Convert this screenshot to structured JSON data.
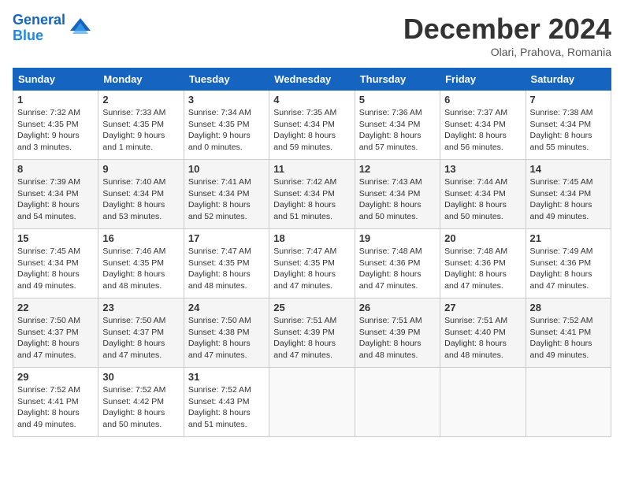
{
  "header": {
    "logo_line1": "General",
    "logo_line2": "Blue",
    "month": "December 2024",
    "location": "Olari, Prahova, Romania"
  },
  "days_of_week": [
    "Sunday",
    "Monday",
    "Tuesday",
    "Wednesday",
    "Thursday",
    "Friday",
    "Saturday"
  ],
  "weeks": [
    [
      {
        "day": 1,
        "sunrise": "7:32 AM",
        "sunset": "4:35 PM",
        "daylight": "9 hours and 3 minutes."
      },
      {
        "day": 2,
        "sunrise": "7:33 AM",
        "sunset": "4:35 PM",
        "daylight": "9 hours and 1 minute."
      },
      {
        "day": 3,
        "sunrise": "7:34 AM",
        "sunset": "4:35 PM",
        "daylight": "9 hours and 0 minutes."
      },
      {
        "day": 4,
        "sunrise": "7:35 AM",
        "sunset": "4:34 PM",
        "daylight": "8 hours and 59 minutes."
      },
      {
        "day": 5,
        "sunrise": "7:36 AM",
        "sunset": "4:34 PM",
        "daylight": "8 hours and 57 minutes."
      },
      {
        "day": 6,
        "sunrise": "7:37 AM",
        "sunset": "4:34 PM",
        "daylight": "8 hours and 56 minutes."
      },
      {
        "day": 7,
        "sunrise": "7:38 AM",
        "sunset": "4:34 PM",
        "daylight": "8 hours and 55 minutes."
      }
    ],
    [
      {
        "day": 8,
        "sunrise": "7:39 AM",
        "sunset": "4:34 PM",
        "daylight": "8 hours and 54 minutes."
      },
      {
        "day": 9,
        "sunrise": "7:40 AM",
        "sunset": "4:34 PM",
        "daylight": "8 hours and 53 minutes."
      },
      {
        "day": 10,
        "sunrise": "7:41 AM",
        "sunset": "4:34 PM",
        "daylight": "8 hours and 52 minutes."
      },
      {
        "day": 11,
        "sunrise": "7:42 AM",
        "sunset": "4:34 PM",
        "daylight": "8 hours and 51 minutes."
      },
      {
        "day": 12,
        "sunrise": "7:43 AM",
        "sunset": "4:34 PM",
        "daylight": "8 hours and 50 minutes."
      },
      {
        "day": 13,
        "sunrise": "7:44 AM",
        "sunset": "4:34 PM",
        "daylight": "8 hours and 50 minutes."
      },
      {
        "day": 14,
        "sunrise": "7:45 AM",
        "sunset": "4:34 PM",
        "daylight": "8 hours and 49 minutes."
      }
    ],
    [
      {
        "day": 15,
        "sunrise": "7:45 AM",
        "sunset": "4:34 PM",
        "daylight": "8 hours and 49 minutes."
      },
      {
        "day": 16,
        "sunrise": "7:46 AM",
        "sunset": "4:35 PM",
        "daylight": "8 hours and 48 minutes."
      },
      {
        "day": 17,
        "sunrise": "7:47 AM",
        "sunset": "4:35 PM",
        "daylight": "8 hours and 48 minutes."
      },
      {
        "day": 18,
        "sunrise": "7:47 AM",
        "sunset": "4:35 PM",
        "daylight": "8 hours and 47 minutes."
      },
      {
        "day": 19,
        "sunrise": "7:48 AM",
        "sunset": "4:36 PM",
        "daylight": "8 hours and 47 minutes."
      },
      {
        "day": 20,
        "sunrise": "7:48 AM",
        "sunset": "4:36 PM",
        "daylight": "8 hours and 47 minutes."
      },
      {
        "day": 21,
        "sunrise": "7:49 AM",
        "sunset": "4:36 PM",
        "daylight": "8 hours and 47 minutes."
      }
    ],
    [
      {
        "day": 22,
        "sunrise": "7:50 AM",
        "sunset": "4:37 PM",
        "daylight": "8 hours and 47 minutes."
      },
      {
        "day": 23,
        "sunrise": "7:50 AM",
        "sunset": "4:37 PM",
        "daylight": "8 hours and 47 minutes."
      },
      {
        "day": 24,
        "sunrise": "7:50 AM",
        "sunset": "4:38 PM",
        "daylight": "8 hours and 47 minutes."
      },
      {
        "day": 25,
        "sunrise": "7:51 AM",
        "sunset": "4:39 PM",
        "daylight": "8 hours and 47 minutes."
      },
      {
        "day": 26,
        "sunrise": "7:51 AM",
        "sunset": "4:39 PM",
        "daylight": "8 hours and 48 minutes."
      },
      {
        "day": 27,
        "sunrise": "7:51 AM",
        "sunset": "4:40 PM",
        "daylight": "8 hours and 48 minutes."
      },
      {
        "day": 28,
        "sunrise": "7:52 AM",
        "sunset": "4:41 PM",
        "daylight": "8 hours and 49 minutes."
      }
    ],
    [
      {
        "day": 29,
        "sunrise": "7:52 AM",
        "sunset": "4:41 PM",
        "daylight": "8 hours and 49 minutes."
      },
      {
        "day": 30,
        "sunrise": "7:52 AM",
        "sunset": "4:42 PM",
        "daylight": "8 hours and 50 minutes."
      },
      {
        "day": 31,
        "sunrise": "7:52 AM",
        "sunset": "4:43 PM",
        "daylight": "8 hours and 51 minutes."
      },
      null,
      null,
      null,
      null
    ]
  ]
}
